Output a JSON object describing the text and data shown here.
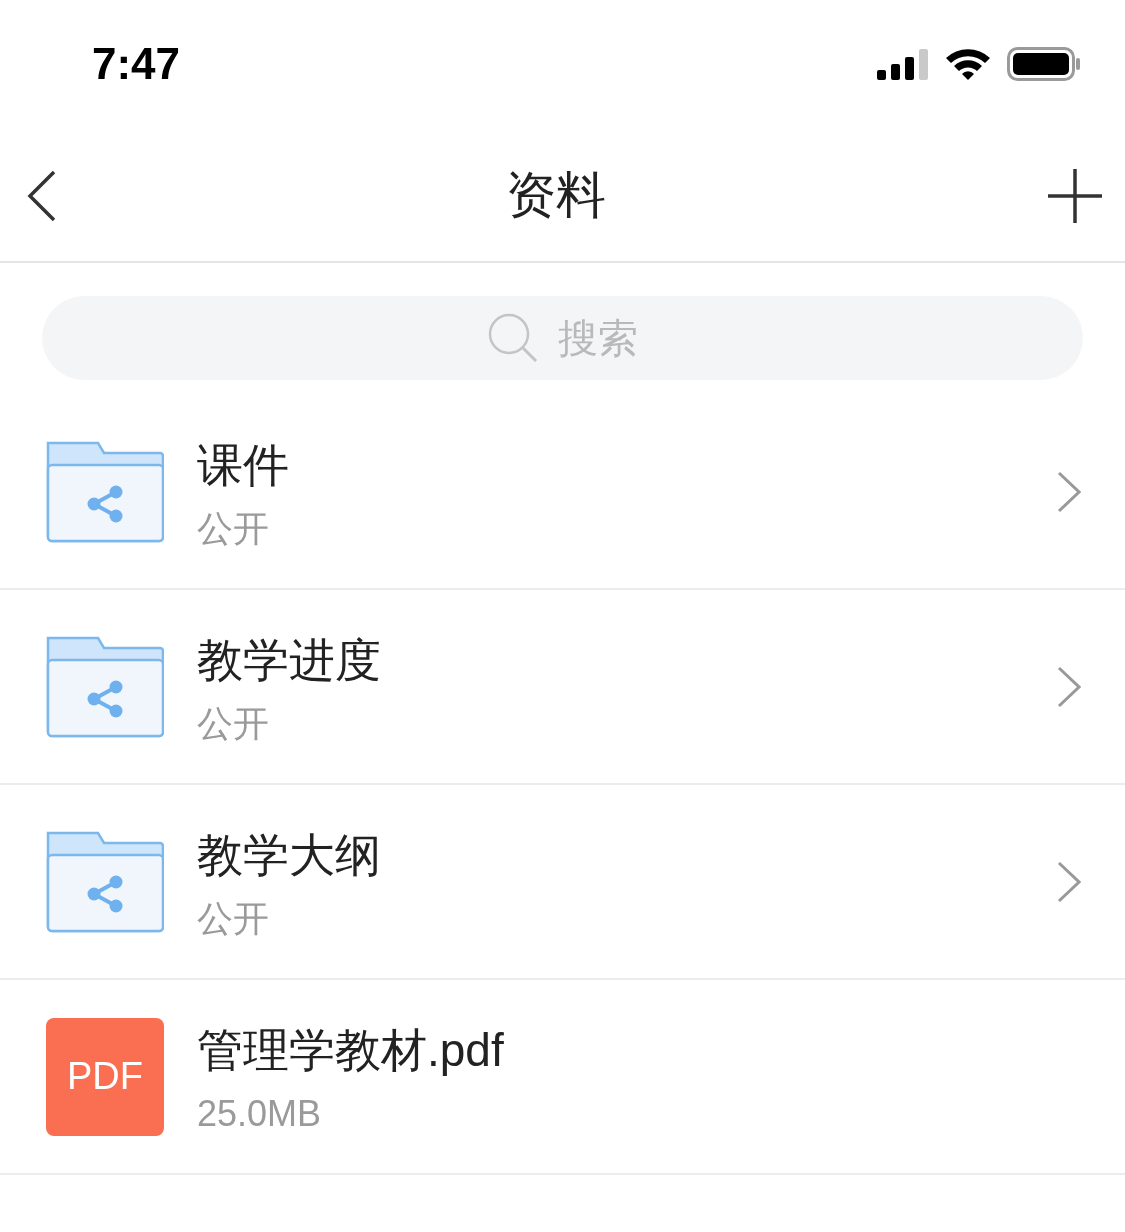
{
  "status_bar": {
    "time": "7:47"
  },
  "nav": {
    "title": "资料"
  },
  "search": {
    "placeholder": "搜索"
  },
  "items": [
    {
      "kind": "folder",
      "name": "课件",
      "subtitle": "公开"
    },
    {
      "kind": "folder",
      "name": "教学进度",
      "subtitle": "公开"
    },
    {
      "kind": "folder",
      "name": "教学大纲",
      "subtitle": "公开"
    },
    {
      "kind": "pdf",
      "badge": "PDF",
      "name": "管理学教材.pdf",
      "subtitle": "25.0MB"
    }
  ]
}
